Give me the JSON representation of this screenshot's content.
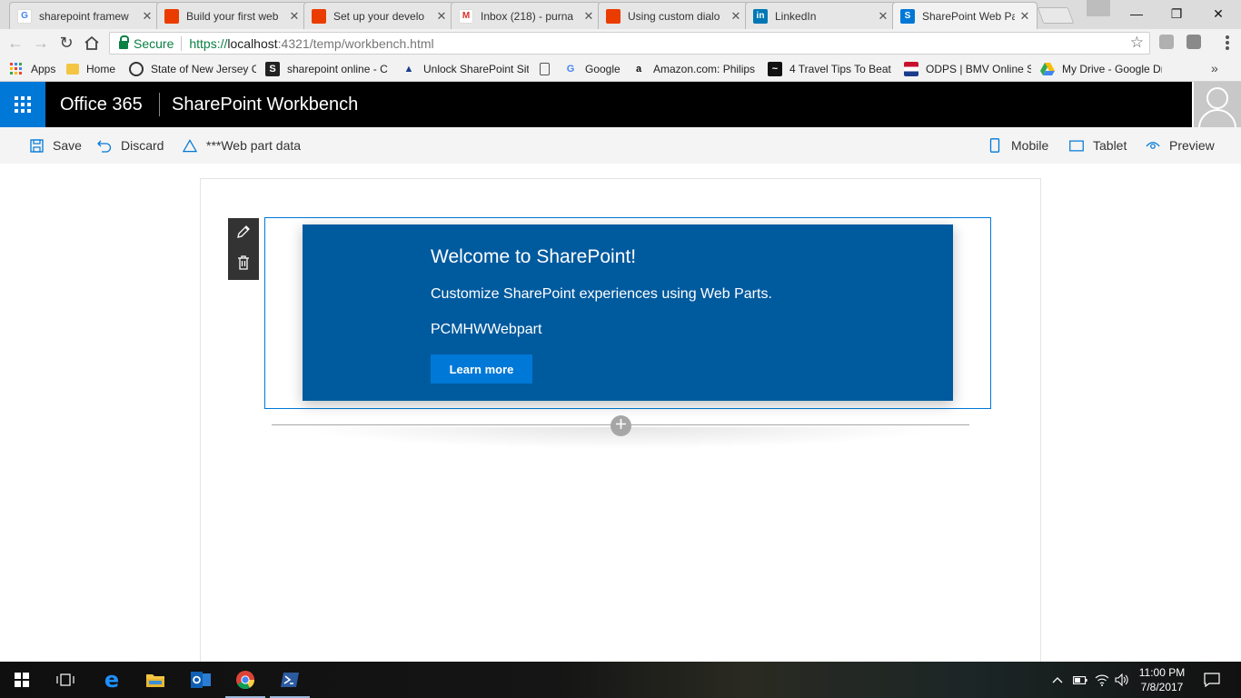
{
  "browser": {
    "tabs": [
      {
        "title": "sharepoint framew",
        "favicon": "google-icon",
        "color": "#4285f4"
      },
      {
        "title": "Build your first web",
        "favicon": "office-icon",
        "color": "#eb3c00"
      },
      {
        "title": "Set up your develo",
        "favicon": "office-icon",
        "color": "#eb3c00"
      },
      {
        "title": "Inbox (218) - purna",
        "favicon": "gmail-icon",
        "color": "#d93025"
      },
      {
        "title": "Using custom dialo",
        "favicon": "office-icon",
        "color": "#eb3c00"
      },
      {
        "title": "LinkedIn",
        "favicon": "linkedin-icon",
        "color": "#0077b5"
      },
      {
        "title": "SharePoint Web Pa",
        "favicon": "sharepoint-icon",
        "color": "#0078d7"
      }
    ],
    "secure_label": "Secure",
    "url": {
      "scheme": "https://",
      "host": "localhost",
      "path": ":4321/temp/workbench.html"
    },
    "bookmarks": [
      {
        "label": "Apps",
        "icon": "apps-grid-icon"
      },
      {
        "label": "Home",
        "icon": "folder-icon"
      },
      {
        "label": "State of New Jersey C",
        "icon": "nj-seal-icon"
      },
      {
        "label": "sharepoint online - C",
        "icon": "sharepoint-online-icon"
      },
      {
        "label": "Unlock SharePoint Sit",
        "icon": "unlock-icon"
      },
      {
        "label": "",
        "icon": "page-icon"
      },
      {
        "label": "Google",
        "icon": "google-icon"
      },
      {
        "label": "Amazon.com: Philips",
        "icon": "amazon-icon"
      },
      {
        "label": "4 Travel Tips To Beat",
        "icon": "travel-icon"
      },
      {
        "label": "ODPS | BMV Online S",
        "icon": "ohio-flag-icon"
      },
      {
        "label": "My Drive - Google Dr",
        "icon": "drive-icon"
      }
    ],
    "bookmarks_more": "»"
  },
  "suite": {
    "brand": "Office 365",
    "title": "SharePoint Workbench"
  },
  "commands": {
    "save": "Save",
    "discard": "Discard",
    "webpart_data": "***Web part data",
    "mobile": "Mobile",
    "tablet": "Tablet",
    "preview": "Preview"
  },
  "webpart": {
    "title": "Welcome to SharePoint!",
    "subtitle": "Customize SharePoint experiences using Web Parts.",
    "description": "PCMHWWebpart",
    "button": "Learn more",
    "background": "#005a9e",
    "button_color": "#0078d7"
  },
  "taskbar": {
    "items": [
      "windows-start-icon",
      "task-view-icon",
      "edge-icon",
      "file-explorer-icon",
      "outlook-icon",
      "chrome-icon",
      "powershell-icon"
    ],
    "time": "11:00 PM",
    "date": "7/8/2017"
  },
  "colors": {
    "accent": "#0078d7",
    "secure_green": "#0b8043"
  }
}
